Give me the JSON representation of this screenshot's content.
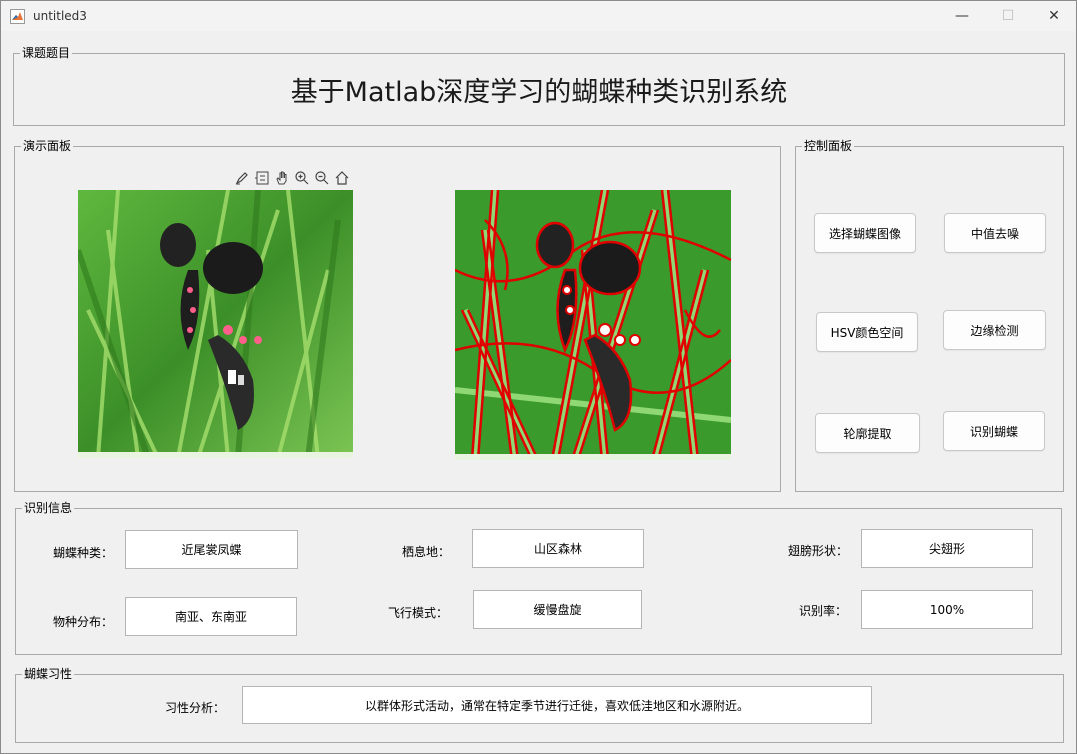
{
  "window": {
    "title": "untitled3",
    "minimize": "—",
    "maximize": "☐",
    "close": "✕"
  },
  "topic_panel": {
    "legend": "课题题目",
    "title": "基于Matlab深度学习的蝴蝶种类识别系统"
  },
  "demo_panel": {
    "legend": "演示面板"
  },
  "control_panel": {
    "legend": "控制面板",
    "buttons": {
      "select_image": "选择蝴蝶图像",
      "median_denoise": "中值去噪",
      "hsv": "HSV颜色空间",
      "edge_detect": "边缘检测",
      "contour": "轮廓提取",
      "recognize": "识别蝴蝶"
    }
  },
  "info_panel": {
    "legend": "识别信息",
    "species_label": "蝴蝶种类：",
    "species_value": "近尾裳凤蝶",
    "habitat_label": "栖息地：",
    "habitat_value": "山区森林",
    "wing_label": "翅膀形状：",
    "wing_value": "尖翅形",
    "distribution_label": "物种分布：",
    "distribution_value": "南亚、东南亚",
    "flight_label": "飞行模式：",
    "flight_value": "缓慢盘旋",
    "rate_label": "识别率：",
    "rate_value": "100%"
  },
  "habit_panel": {
    "legend": "蝴蝶习性",
    "analysis_label": "习性分析：",
    "analysis_value": "以群体形式活动，通常在特定季节进行迁徙，喜欢低洼地区和水源附近。"
  },
  "icons": [
    "matlab-icon",
    "brush-icon",
    "datatip-icon",
    "pan-hand-icon",
    "zoom-in-icon",
    "zoom-out-icon",
    "home-icon"
  ],
  "colors": {
    "window_bg": "#f0f0f0",
    "edge_red": "#e00000",
    "grass_green": "#3f9a2c"
  }
}
